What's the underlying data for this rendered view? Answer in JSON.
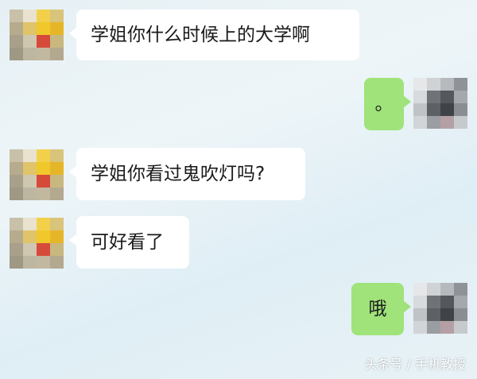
{
  "messages": [
    {
      "side": "in",
      "text": "学姐你什么时候上的大学啊"
    },
    {
      "side": "out",
      "text": "。"
    },
    {
      "side": "in",
      "text": "学姐你看过鬼吹灯吗?"
    },
    {
      "side": "in",
      "text": "可好看了"
    },
    {
      "side": "out",
      "text": "哦"
    }
  ],
  "watermark": "头条号 / 手机教授",
  "colors": {
    "incoming_bubble": "#ffffff",
    "outgoing_bubble": "#9fe37a",
    "background": "#e6f0f4"
  },
  "avatars": {
    "contact": "pixelated-avatar-yellow-red",
    "self": "pixelated-avatar-gray"
  }
}
